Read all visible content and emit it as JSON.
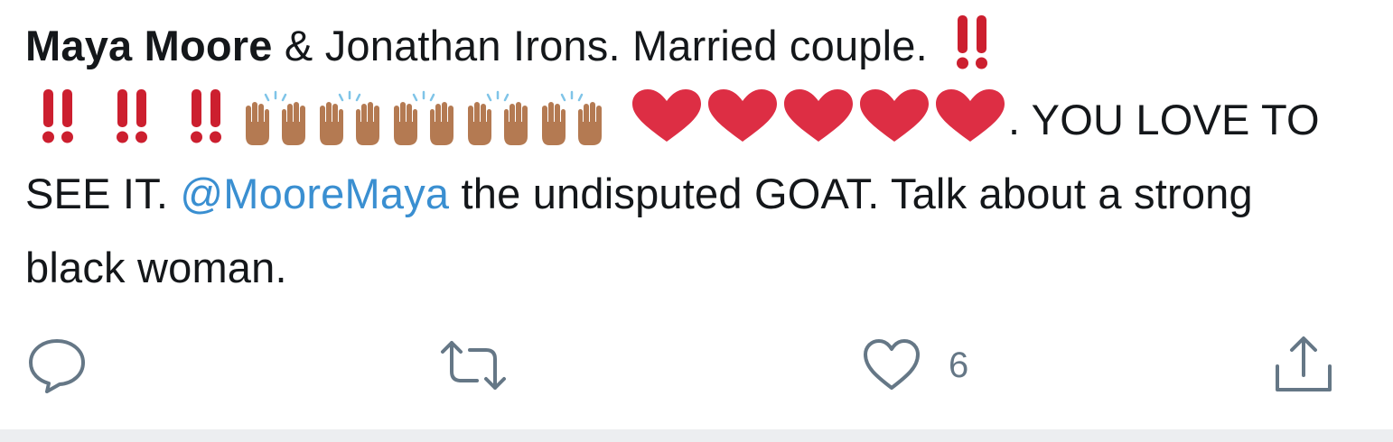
{
  "tweet": {
    "author_bold": "Maya Moore",
    "text_after_author": " & Jonathan Irons. Married couple. ",
    "emoji_tail_text": ". YOU LOVE TO SEE IT. ",
    "mention": "@MooreMaya",
    "text_after_mention": " the undisputed GOAT. Talk about a strong black woman.",
    "mention_color": "#3a8fd1",
    "text_color": "#14171a"
  },
  "emojis": {
    "double_exclamation_icon": "double-exclamation-icon",
    "raising_hands_icon": "raising-hands-icon",
    "heart_icon": "red-heart-icon",
    "exclamation_color": "#cc1f2f",
    "heart_color": "#dd2e44",
    "hands_color": "#b47a52"
  },
  "actions": {
    "reply_icon": "reply-icon",
    "retweet_icon": "retweet-icon",
    "like_icon": "heart-outline-icon",
    "like_count": "6",
    "share_icon": "share-icon",
    "icon_color": "#657786"
  }
}
